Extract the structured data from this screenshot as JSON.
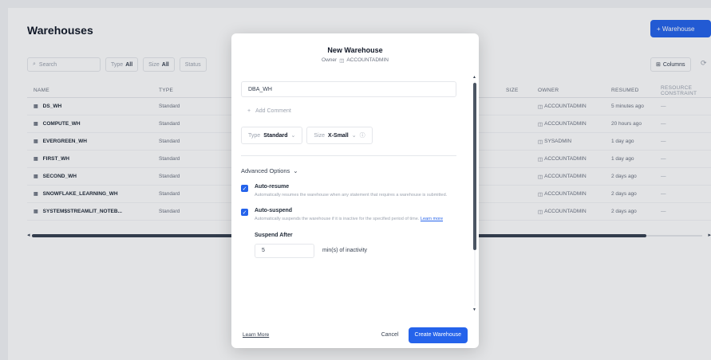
{
  "page": {
    "title": "Warehouses",
    "add_button": "+ Warehouse"
  },
  "filters": {
    "search_placeholder": "Search",
    "type_label": "Type",
    "type_value": "All",
    "size_label": "Size",
    "size_value": "All",
    "status_label": "Status",
    "columns_label": "Columns"
  },
  "table": {
    "headers": [
      "NAME",
      "TYPE",
      "SIZE",
      "OWNER",
      "RESUMED",
      "RESOURCE CONSTRAINT"
    ],
    "rows": [
      {
        "name": "DS_WH",
        "type": "Standard",
        "owner": "ACCOUNTADMIN",
        "resumed": "5 minutes ago",
        "rc": "—"
      },
      {
        "name": "COMPUTE_WH",
        "type": "Standard",
        "owner": "ACCOUNTADMIN",
        "resumed": "20 hours ago",
        "rc": "—"
      },
      {
        "name": "EVERGREEN_WH",
        "type": "Standard",
        "owner": "SYSADMIN",
        "resumed": "1 day ago",
        "rc": "—"
      },
      {
        "name": "FIRST_WH",
        "type": "Standard",
        "owner": "ACCOUNTADMIN",
        "resumed": "1 day ago",
        "rc": "—"
      },
      {
        "name": "SECOND_WH",
        "type": "Standard",
        "owner": "ACCOUNTADMIN",
        "resumed": "2 days ago",
        "rc": "—"
      },
      {
        "name": "SNOWFLAKE_LEARNING_WH",
        "type": "Standard",
        "owner": "ACCOUNTADMIN",
        "resumed": "2 days ago",
        "rc": "—"
      },
      {
        "name": "SYSTEM$STREAMLIT_NOTEB...",
        "type": "Standard",
        "owner": "ACCOUNTADMIN",
        "resumed": "2 days ago",
        "rc": "—"
      }
    ]
  },
  "modal": {
    "title": "New Warehouse",
    "owner_prefix": "Owner",
    "owner_value": "ACCOUNTADMIN",
    "name_value": "DBA_WH",
    "add_comment": "Add Comment",
    "type_label": "Type",
    "type_value": "Standard",
    "size_label": "Size",
    "size_value": "X-Small",
    "advanced_options": "Advanced Options",
    "auto_resume_label": "Auto-resume",
    "auto_resume_desc": "Automatically resumes the warehouse when any statement that requires a warehouse is submitted.",
    "auto_suspend_label": "Auto-suspend",
    "auto_suspend_desc": "Automatically suspends the warehouse if it is inactive for the specified period of time.",
    "learn_more": "Learn more",
    "suspend_after_label": "Suspend After",
    "suspend_after_value": "5",
    "suspend_unit": "min(s) of inactivity",
    "footer_link": "Learn More",
    "cancel_label": "Cancel",
    "create_label": "Create Warehouse"
  },
  "colors": {
    "accent": "#2563eb",
    "overlay": "rgba(17,24,39,0.12)"
  },
  "icons": [
    "search-icon",
    "columns-icon",
    "more-icon",
    "warehouse-icon",
    "owner-role-icon",
    "plus-icon",
    "chevron-down-icon",
    "info-icon",
    "checkmark-icon"
  ]
}
